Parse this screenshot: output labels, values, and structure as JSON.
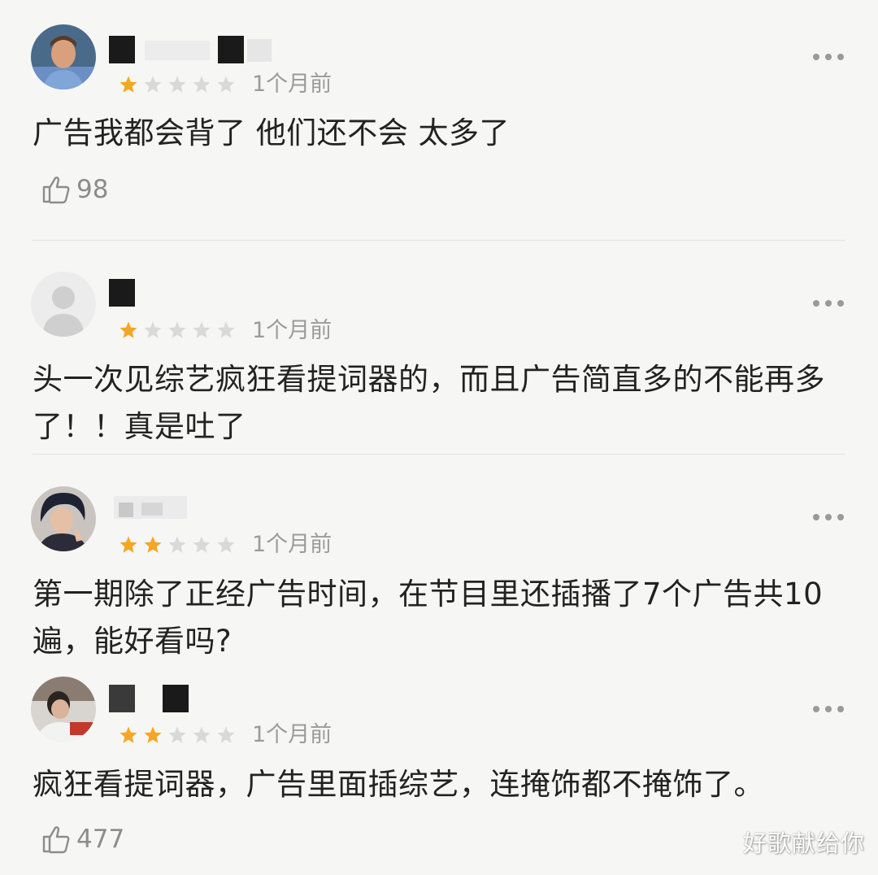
{
  "reviews": [
    {
      "time": "1个月前",
      "rating": 1,
      "text": "广告我都会背了 他们还不会 太多了",
      "likes": "98"
    },
    {
      "time": "1个月前",
      "rating": 1,
      "text": "头一次见综艺疯狂看提词器的，而且广告简直多的不能再多了！！真是吐了"
    },
    {
      "time": "1个月前",
      "rating": 2,
      "text": "第一期除了正经广告时间，在节目里还插播了7个广告共10遍，能好看吗?"
    },
    {
      "time": "1个月前",
      "rating": 2,
      "text": "疯狂看提词器，广告里面插综艺，连掩饰都不掩饰了。",
      "likes": "477"
    }
  ],
  "icons": {
    "more": "more-dots-icon",
    "like": "thumbs-up-icon",
    "star": "star-icon"
  },
  "colors": {
    "star_filled": "#f5a623",
    "star_empty": "#d9d9d9",
    "meta": "#9b9b9b"
  },
  "watermark": "好歌献给你"
}
